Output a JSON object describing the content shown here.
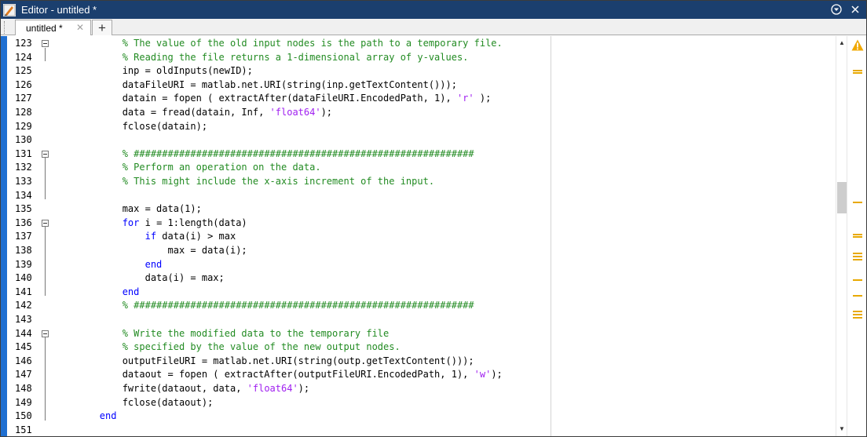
{
  "window": {
    "title": "Editor - untitled *",
    "app_icon": "matlab-editor-icon",
    "accent_color": "#1b3f6e"
  },
  "tabs": [
    {
      "label": "untitled *",
      "close_glyph": "✕"
    }
  ],
  "add_tab_label": "+",
  "titlebar_buttons": {
    "menu_glyph": "⊙",
    "close_glyph": "✕"
  },
  "code": {
    "lines": [
      {
        "num": "123",
        "segments": [
          {
            "t": "            "
          },
          {
            "t": "% The value of the old input nodes is the path to a temporary file.",
            "s": "com"
          }
        ]
      },
      {
        "num": "124",
        "segments": [
          {
            "t": "            "
          },
          {
            "t": "% Reading the file returns a 1-dimensional array of y-values.",
            "s": "com"
          }
        ]
      },
      {
        "num": "125",
        "segments": [
          {
            "t": "            inp = oldInputs(newID);"
          }
        ]
      },
      {
        "num": "126",
        "segments": [
          {
            "t": "            dataFileURI = matlab.net.URI(string(inp.getTextContent()));"
          }
        ]
      },
      {
        "num": "127",
        "segments": [
          {
            "t": "            datain = fopen ( extractAfter(dataFileURI.EncodedPath, 1), "
          },
          {
            "t": "'r'",
            "s": "str"
          },
          {
            "t": " );"
          }
        ]
      },
      {
        "num": "128",
        "segments": [
          {
            "t": "            data = fread(datain, Inf, "
          },
          {
            "t": "'float64'",
            "s": "str"
          },
          {
            "t": ");"
          }
        ]
      },
      {
        "num": "129",
        "segments": [
          {
            "t": "            fclose(datain);"
          }
        ]
      },
      {
        "num": "130",
        "segments": [
          {
            "t": ""
          }
        ]
      },
      {
        "num": "131",
        "segments": [
          {
            "t": "            "
          },
          {
            "t": "% ############################################################",
            "s": "com"
          }
        ]
      },
      {
        "num": "132",
        "segments": [
          {
            "t": "            "
          },
          {
            "t": "% Perform an operation on the data.",
            "s": "com"
          }
        ]
      },
      {
        "num": "133",
        "segments": [
          {
            "t": "            "
          },
          {
            "t": "% This might include the x-axis increment of the input.",
            "s": "com"
          }
        ]
      },
      {
        "num": "134",
        "segments": [
          {
            "t": ""
          }
        ]
      },
      {
        "num": "135",
        "segments": [
          {
            "t": "            max = data(1);"
          }
        ]
      },
      {
        "num": "136",
        "segments": [
          {
            "t": "            "
          },
          {
            "t": "for",
            "s": "kw"
          },
          {
            "t": " i = 1:length(data)"
          }
        ]
      },
      {
        "num": "137",
        "segments": [
          {
            "t": "                "
          },
          {
            "t": "if",
            "s": "kw"
          },
          {
            "t": " data(i) > max"
          }
        ]
      },
      {
        "num": "138",
        "segments": [
          {
            "t": "                    max = data(i);"
          }
        ]
      },
      {
        "num": "139",
        "segments": [
          {
            "t": "                "
          },
          {
            "t": "end",
            "s": "kw"
          }
        ]
      },
      {
        "num": "140",
        "segments": [
          {
            "t": "                data(i) = max;"
          }
        ]
      },
      {
        "num": "141",
        "segments": [
          {
            "t": "            "
          },
          {
            "t": "end",
            "s": "kw"
          }
        ]
      },
      {
        "num": "142",
        "segments": [
          {
            "t": "            "
          },
          {
            "t": "% ############################################################",
            "s": "com"
          }
        ]
      },
      {
        "num": "143",
        "segments": [
          {
            "t": ""
          }
        ]
      },
      {
        "num": "144",
        "segments": [
          {
            "t": "            "
          },
          {
            "t": "% Write the modified data to the temporary file",
            "s": "com"
          }
        ]
      },
      {
        "num": "145",
        "segments": [
          {
            "t": "            "
          },
          {
            "t": "% specified by the value of the new output nodes.",
            "s": "com"
          }
        ]
      },
      {
        "num": "146",
        "segments": [
          {
            "t": "            outputFileURI = matlab.net.URI(string(outp.getTextContent()));"
          }
        ]
      },
      {
        "num": "147",
        "segments": [
          {
            "t": "            dataout = fopen ( extractAfter(outputFileURI.EncodedPath, 1), "
          },
          {
            "t": "'w'",
            "s": "str"
          },
          {
            "t": ");"
          }
        ]
      },
      {
        "num": "148",
        "segments": [
          {
            "t": "            fwrite(dataout, data, "
          },
          {
            "t": "'float64'",
            "s": "str"
          },
          {
            "t": ");"
          }
        ]
      },
      {
        "num": "149",
        "segments": [
          {
            "t": "            fclose(dataout);"
          }
        ]
      },
      {
        "num": "150",
        "segments": [
          {
            "t": "        "
          },
          {
            "t": "end",
            "s": "kw"
          }
        ]
      },
      {
        "num": "151",
        "segments": [
          {
            "t": ""
          }
        ]
      }
    ]
  },
  "colors": {
    "comment": "#228b22",
    "keyword": "#0000ff",
    "string": "#a020f0",
    "warning": "#e8a900",
    "left_margin": "#1f6fd1"
  },
  "analyzer": {
    "status_icon": "warning-icon"
  }
}
